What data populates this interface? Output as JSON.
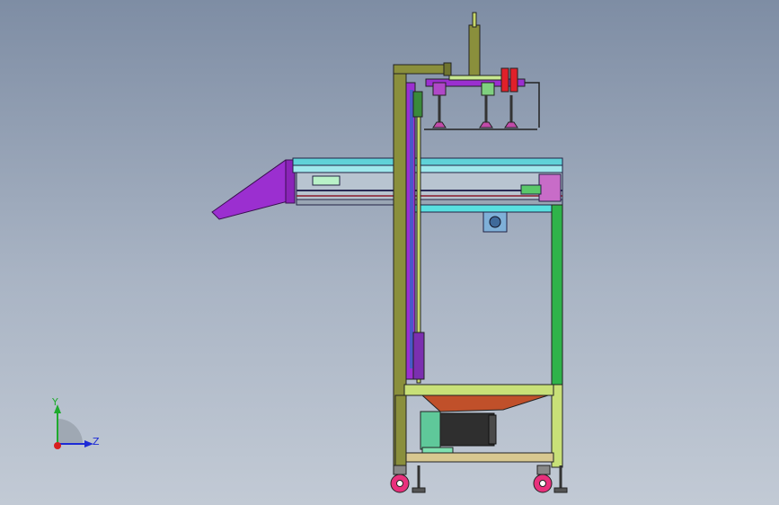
{
  "viewport": {
    "background_top": "#7e8da4",
    "background_bottom": "#c2cad5",
    "model": {
      "frame_color": "#8a8f3c",
      "conveyor_color": "#5fd2d8",
      "chute_color": "#9b2fd0",
      "leg_green": "#2fb34a",
      "motor_color": "#2f2f2f",
      "plate_orange": "#c0502a",
      "cylinder_red": "#e0202a",
      "caster_pink": "#e8307c",
      "shelf_tan": "#d8c890"
    }
  },
  "triad": {
    "y_label": "Y",
    "z_label": "Z",
    "y_color": "#1faa2e",
    "z_color": "#1d2bd6",
    "x_color": "#d81e1e"
  }
}
